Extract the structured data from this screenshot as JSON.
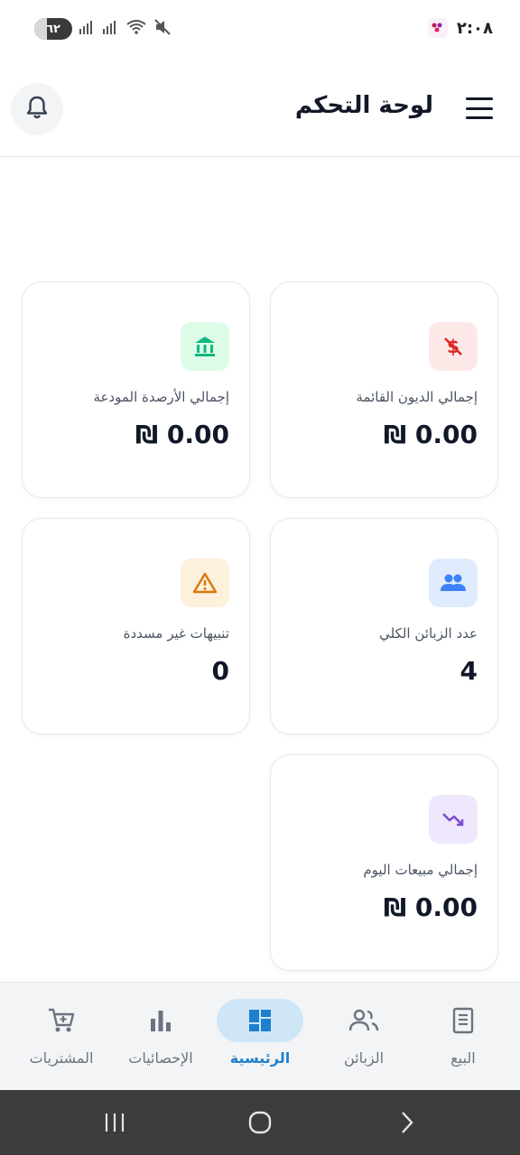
{
  "status_bar": {
    "time": "٢:٠٨",
    "battery": "٦٢"
  },
  "header": {
    "title": "لوحة التحكم"
  },
  "cards": {
    "deposits": {
      "label": "إجمالي الأرصدة المودعة",
      "value": "0.00 ₪",
      "icon": "bank-icon"
    },
    "debts": {
      "label": "إجمالي الديون القائمة",
      "value": "0.00 ₪",
      "icon": "money-off-icon"
    },
    "alerts": {
      "label": "تنبيهات غير مسددة",
      "value": "0",
      "icon": "warning-icon"
    },
    "customers": {
      "label": "عدد الزبائن الكلي",
      "value": "4",
      "icon": "people-icon"
    },
    "today_sales": {
      "label": "إجمالي مبيعات اليوم",
      "value": "0.00 ₪",
      "icon": "trending-down-icon"
    }
  },
  "nav": {
    "sales": "البيع",
    "customers": "الزبائن",
    "home": "الرئيسية",
    "stats": "الإحصائيات",
    "purchases": "المشتريات"
  },
  "colors": {
    "accent": "#1f7fcf",
    "green": "#10b981",
    "red": "#dc2626",
    "amber": "#d97706",
    "blue": "#3b82f6",
    "purple": "#7c4dcc"
  }
}
